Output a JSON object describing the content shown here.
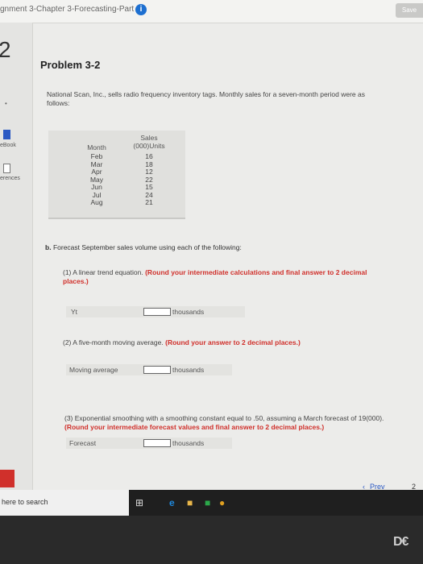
{
  "header": {
    "assignment_title": "gnment 3-Chapter 3-Forecasting-Part 1",
    "info_icon": "i",
    "save_label": "Save"
  },
  "leftnav": {
    "question_number": "2",
    "dot": "•",
    "ebook_label": "eBook",
    "references_label": "erences"
  },
  "problem": {
    "title": "Problem 3-2",
    "intro": "National Scan, Inc., sells radio frequency inventory tags. Monthly sales for a seven-month period were as follows:",
    "table": {
      "header_month": "Month",
      "header_sales_line1": "Sales",
      "header_sales_line2": "(000)Units",
      "rows": [
        {
          "month": "Feb",
          "sales": "16"
        },
        {
          "month": "Mar",
          "sales": "18"
        },
        {
          "month": "Apr",
          "sales": "12"
        },
        {
          "month": "May",
          "sales": "22"
        },
        {
          "month": "Jun",
          "sales": "15"
        },
        {
          "month": "Jul",
          "sales": "24"
        },
        {
          "month": "Aug",
          "sales": "21"
        }
      ]
    },
    "part_b_label": "b.",
    "part_b_text": "Forecast September sales volume using each of the following:",
    "q1_text": "(1)  A linear trend equation.",
    "q1_instruction": "(Round your intermediate calculations and final answer to 2 decimal places.)",
    "q1_answer_label": "Yt",
    "q1_answer_value": "",
    "q1_unit": "thousands",
    "q2_text": "(2)  A five-month moving average.",
    "q2_instruction": "(Round your answer to 2 decimal places.)",
    "q2_answer_label": "Moving average",
    "q2_answer_value": "",
    "q2_unit": "thousands",
    "q3_text": "(3)  Exponential smoothing with a smoothing constant equal to .50, assuming a March forecast of 19(000).",
    "q3_instruction": "(Round your intermediate forecast values and final answer to 2 decimal places.)",
    "q3_answer_label": "Forecast",
    "q3_answer_value": "",
    "q3_unit": "thousands"
  },
  "pagination": {
    "prev_label": "Prev",
    "page": "2"
  },
  "taskbar": {
    "search_text": "here to search"
  },
  "bezel": {
    "logo": "D€"
  },
  "colors": {
    "instruction_red": "#d0302b",
    "link_blue": "#2b59c3"
  }
}
